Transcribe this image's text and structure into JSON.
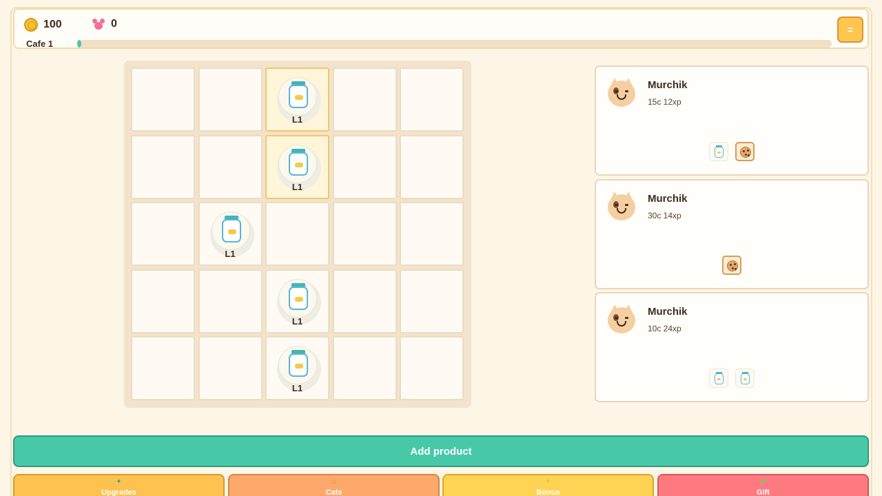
{
  "header": {
    "coins": "100",
    "hearts": "0",
    "cafe_label": "Cafe 1",
    "xp_progress": 0.0,
    "menu_icon": "="
  },
  "board": {
    "rows": 5,
    "cols": 5,
    "items": [
      {
        "row": 0,
        "col": 2,
        "type": "jar",
        "level": "L1",
        "highlight": true
      },
      {
        "row": 1,
        "col": 2,
        "type": "jar",
        "level": "L1",
        "highlight": true
      },
      {
        "row": 2,
        "col": 1,
        "type": "jar",
        "level": "L1",
        "highlight": false
      },
      {
        "row": 3,
        "col": 2,
        "type": "jar",
        "level": "L1",
        "highlight": false
      },
      {
        "row": 4,
        "col": 2,
        "type": "jar",
        "level": "L1",
        "highlight": false
      }
    ]
  },
  "orders": [
    {
      "name": "Murchik",
      "reward": "15c 12xp",
      "requests": [
        "jar",
        "cookie"
      ]
    },
    {
      "name": "Murchik",
      "reward": "30c 14xp",
      "requests": [
        "cookie"
      ]
    },
    {
      "name": "Murchik",
      "reward": "10c 24xp",
      "requests": [
        "jar",
        "jar"
      ]
    }
  ],
  "actions": {
    "add_product": "Add product"
  },
  "nav": [
    {
      "label": "Upgrades",
      "icon": "✦"
    },
    {
      "label": "Cats",
      "icon": "☺"
    },
    {
      "label": "Bonus",
      "icon": "✧"
    },
    {
      "label": "Gift",
      "icon": "✚"
    }
  ]
}
